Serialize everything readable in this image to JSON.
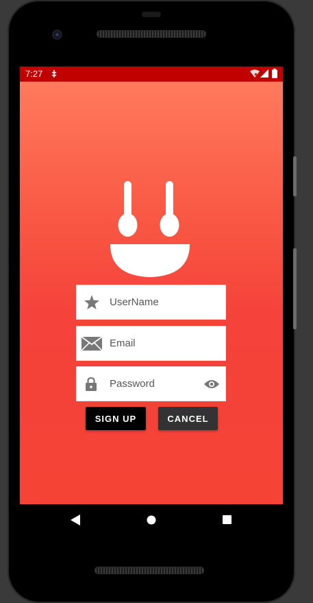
{
  "status_bar": {
    "time": "7:27",
    "icons": [
      "signal-debug-icon",
      "wifi-icon",
      "cell-signal-icon",
      "battery-icon"
    ]
  },
  "app": {
    "background_top": "#ff7a5c",
    "background_bottom": "#f54336",
    "logo_icon": "smiley-bowl-logo"
  },
  "form": {
    "username": {
      "placeholder": "UserName",
      "value": "",
      "icon": "star-icon"
    },
    "email": {
      "placeholder": "Email",
      "value": "",
      "icon": "envelope-icon"
    },
    "password": {
      "placeholder": "Password",
      "value": "",
      "icon": "lock-icon",
      "toggle_icon": "eye-icon"
    }
  },
  "buttons": {
    "signup_label": "SIGN UP",
    "signup_color": "#000000",
    "cancel_label": "CANCEL",
    "cancel_color": "#333333"
  },
  "nav_bar": {
    "icons": [
      "back-triangle-icon",
      "home-circle-icon",
      "recents-square-icon"
    ]
  }
}
